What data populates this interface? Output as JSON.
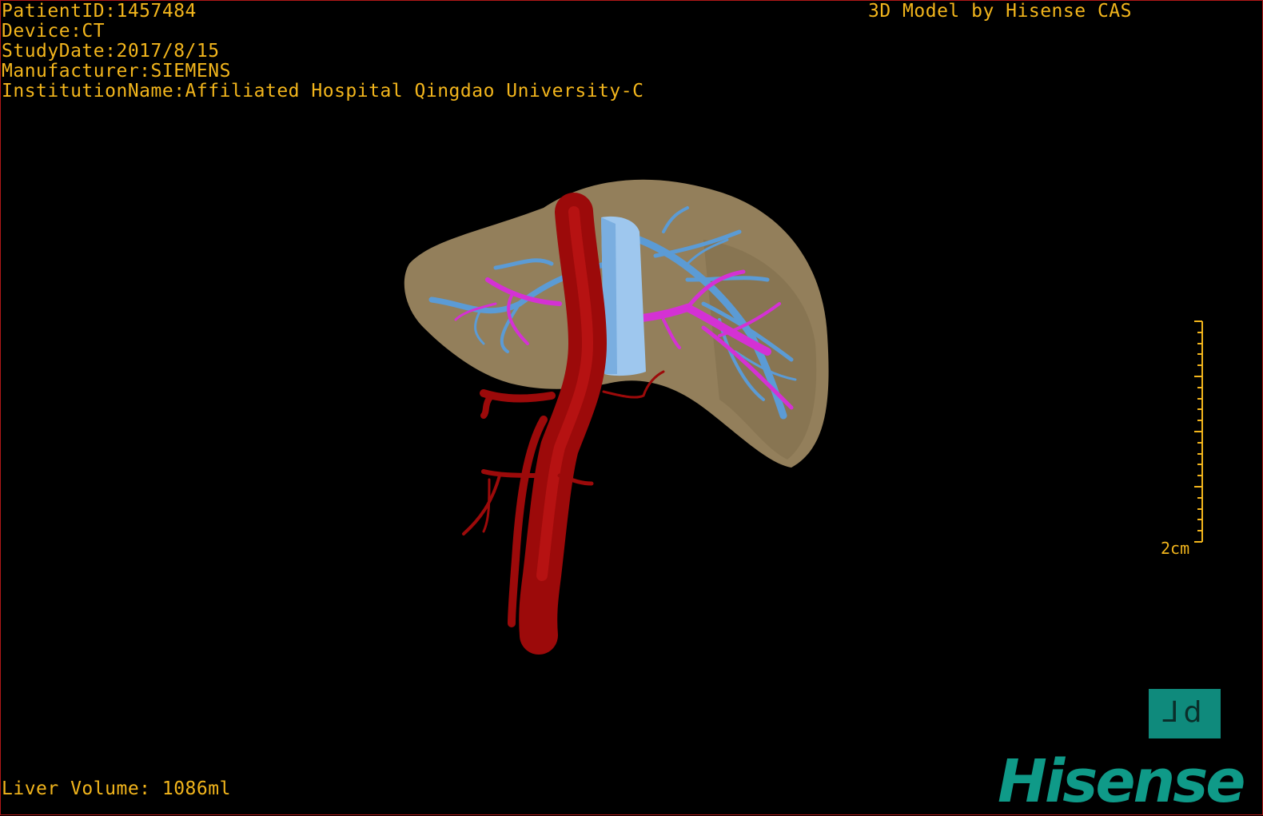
{
  "overlay": {
    "patient_id": "PatientID:1457484",
    "device": "Device:CT",
    "study_date": "StudyDate:2017/8/15",
    "manufacturer": "Manufacturer:SIEMENS",
    "institution": "InstitutionName:Affiliated Hospital Qingdao University-C",
    "credit": "3D Model by Hisense CAS",
    "liver_volume": "Liver Volume: 1086ml"
  },
  "scale_bar": {
    "label": "2cm"
  },
  "view_toggle": {
    "glyph": "⅃d"
  },
  "brand": {
    "name": "Hisense"
  },
  "colors": {
    "overlay_text": "#f2b51c",
    "liver": "#9b8660",
    "aorta": "#9c0a0a",
    "hepatic_vein": "#5b9bd5",
    "ivc": "#9ec7ee",
    "portal_vein": "#d431d4",
    "brand": "#0f9a88",
    "frame": "#b01818"
  }
}
